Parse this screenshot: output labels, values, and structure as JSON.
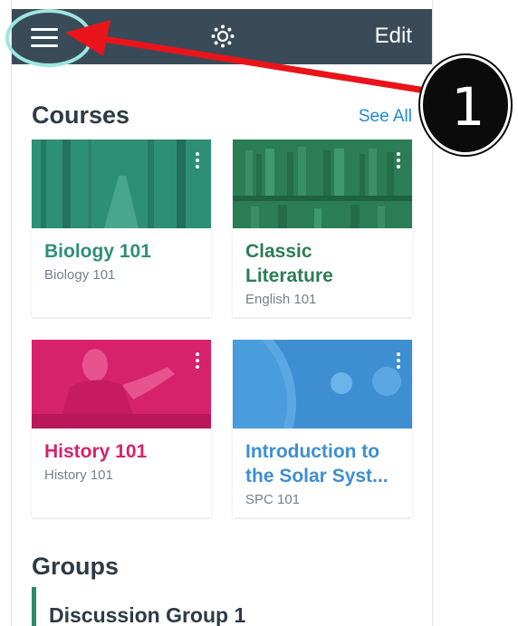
{
  "navbar": {
    "edit_label": "Edit",
    "menu_icon": "hamburger-icon",
    "logo_icon": "canvas-logo-icon",
    "background": "#394b58"
  },
  "courses": {
    "title": "Courses",
    "see_all": "See All",
    "cards": [
      {
        "title": "Biology 101",
        "subtitle": "Biology 101",
        "color": "#2e8f77"
      },
      {
        "title": "Classic Literature",
        "subtitle": "English 101",
        "color": "#2b7d55"
      },
      {
        "title": "History 101",
        "subtitle": "History 101",
        "color": "#d6226b"
      },
      {
        "title": "Introduction to the Solar Syst...",
        "subtitle": "SPC 101",
        "color": "#3d8fd1"
      }
    ]
  },
  "groups": {
    "title": "Groups",
    "items": [
      {
        "name": "Discussion Group 1",
        "color": "#2d8a68"
      }
    ]
  },
  "annotation": {
    "step_number": "1",
    "arrow_color": "#e8141a",
    "ring_color": "#9ee6e0"
  }
}
